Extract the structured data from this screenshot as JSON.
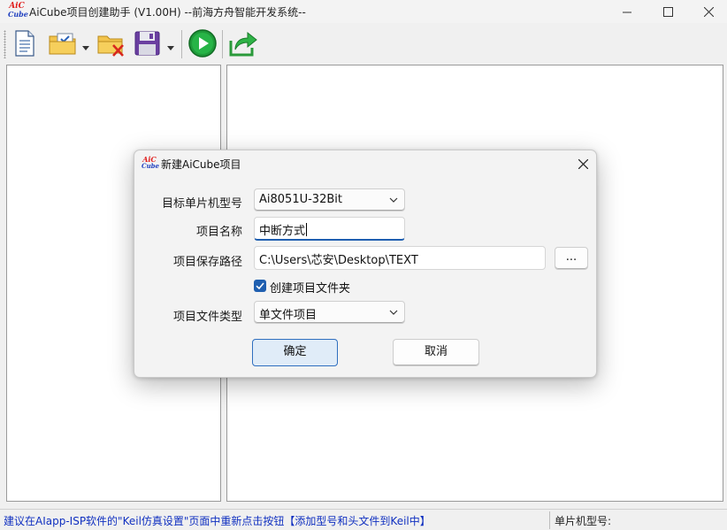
{
  "window": {
    "title": "AiCube项目创建助手 (V1.00H) --前海方舟智能开发系统--",
    "logo_line1": "AiC",
    "logo_line2": "Cube"
  },
  "toolbar": {
    "buttons": [
      {
        "icon": "new-document-icon",
        "has_dropdown": false
      },
      {
        "icon": "open-folder-check-icon",
        "has_dropdown": true
      },
      {
        "icon": "delete-folder-icon",
        "has_dropdown": false
      },
      {
        "icon": "save-disk-icon",
        "has_dropdown": true
      },
      {
        "icon": "run-play-icon",
        "has_dropdown": false
      },
      {
        "icon": "export-share-icon",
        "has_dropdown": false
      }
    ]
  },
  "status": {
    "message": "建议在AIapp-ISP软件的\"Keil仿真设置\"页面中重新点击按钮【添加型号和头文件到Keil中】",
    "mcu_label": "单片机型号:"
  },
  "dialog": {
    "title": "新建AiCube项目",
    "logo_line1": "AiC",
    "logo_line2": "Cube",
    "fields": {
      "mcu_label": "目标单片机型号",
      "mcu_value": "Ai8051U-32Bit",
      "name_label": "项目名称",
      "name_value": "中断方式",
      "path_label": "项目保存路径",
      "path_value": "C:\\Users\\芯安\\Desktop\\TEXT",
      "browse_label": "...",
      "create_folder_label": "创建项目文件夹",
      "create_folder_checked": true,
      "type_label": "项目文件类型",
      "type_value": "单文件项目"
    },
    "ok_label": "确定",
    "cancel_label": "取消"
  },
  "colors": {
    "accent": "#1f5fb0",
    "status_text": "#1030c0",
    "logo_red": "#e0201f",
    "logo_blue": "#1f3fbf"
  }
}
